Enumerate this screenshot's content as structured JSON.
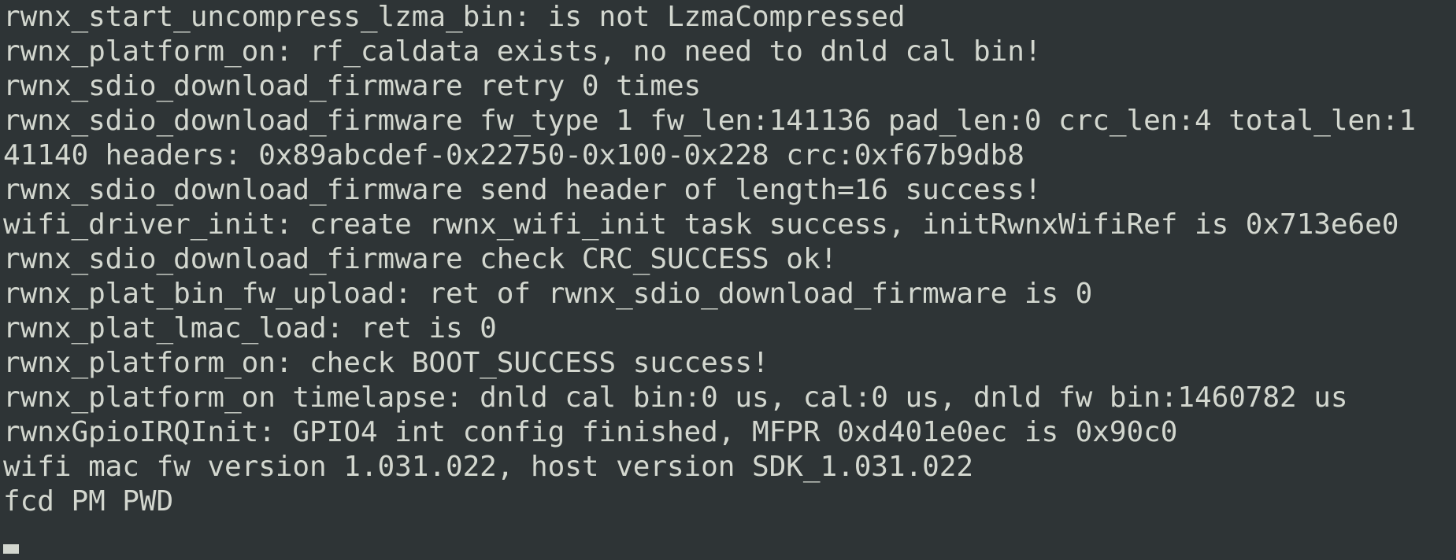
{
  "terminal": {
    "lines": [
      "rwnx_start_uncompress_lzma_bin: is not LzmaCompressed",
      "rwnx_platform_on: rf_caldata exists, no need to dnld cal bin!",
      "rwnx_sdio_download_firmware retry 0 times",
      "rwnx_sdio_download_firmware fw_type 1 fw_len:141136 pad_len:0 crc_len:4 total_len:1",
      "41140 headers: 0x89abcdef-0x22750-0x100-0x228 crc:0xf67b9db8",
      "rwnx_sdio_download_firmware send header of length=16 success!",
      "wifi_driver_init: create rwnx_wifi_init task success, initRwnxWifiRef is 0x713e6e0",
      "rwnx_sdio_download_firmware check CRC_SUCCESS ok!",
      "rwnx_plat_bin_fw_upload: ret of rwnx_sdio_download_firmware is 0",
      "rwnx_plat_lmac_load: ret is 0",
      "rwnx_platform_on: check BOOT_SUCCESS success!",
      "rwnx_platform_on timelapse: dnld cal bin:0 us, cal:0 us, dnld fw bin:1460782 us",
      "rwnxGpioIRQInit: GPIO4 int config finished, MFPR 0xd401e0ec is 0x90c0",
      "wifi mac fw version 1.031.022, host version SDK_1.031.022",
      "fcd PM PWD"
    ],
    "colors": {
      "background": "#2e3436",
      "foreground": "#d3d7cf"
    }
  }
}
